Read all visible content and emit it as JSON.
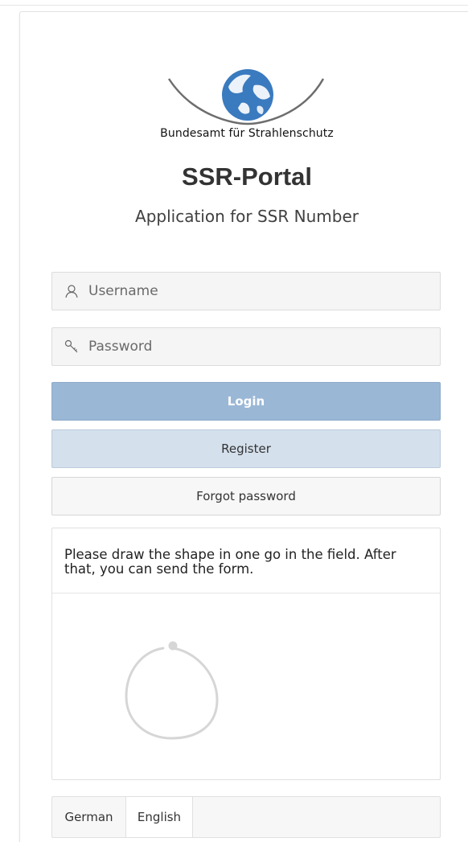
{
  "header": {
    "org_name": "Bundesamt für Strahlenschutz",
    "portal_title": "SSR-Portal",
    "subtitle": "Application for SSR Number"
  },
  "login_form": {
    "username": {
      "placeholder": "Username",
      "value": "",
      "icon": "user-icon"
    },
    "password": {
      "placeholder": "Password",
      "value": "",
      "icon": "key-icon"
    },
    "login_label": "Login",
    "register_label": "Register",
    "forgot_label": "Forgot password"
  },
  "captcha": {
    "instruction": "Please draw the shape in one go in the field. After that, you can send the form.",
    "shape_icon": "circle-shape-icon"
  },
  "language": {
    "options": [
      "German",
      "English"
    ],
    "selected": "English"
  },
  "colors": {
    "login_button": "#9ab7d6",
    "register_button": "#d4e0ec",
    "logo_blue": "#3a7abf"
  }
}
